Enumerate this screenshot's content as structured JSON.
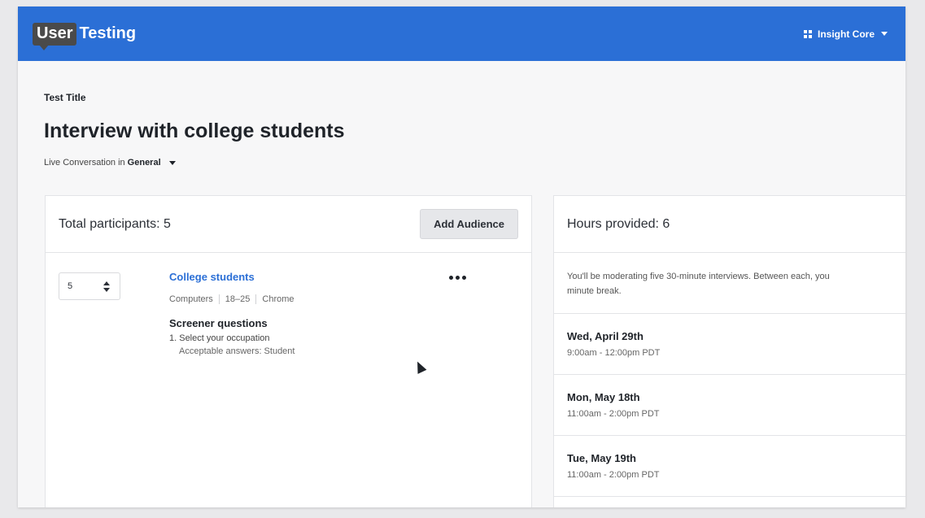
{
  "app": {
    "logo_box": "User",
    "logo_text": "Testing",
    "workspace_label": "Insight Core"
  },
  "test": {
    "label": "Test Title",
    "title": "Interview with college students",
    "type_prefix": "Live Conversation in",
    "category": "General"
  },
  "audience_panel": {
    "title": "Total participants: 5",
    "add_button": "Add Audience",
    "audience": {
      "count": "5",
      "name": "College students",
      "tags": [
        "Computers",
        "18–25",
        "Chrome"
      ],
      "screener_title": "Screener questions",
      "question": "1. Select your occupation",
      "acceptable": "Acceptable answers: Student"
    }
  },
  "hours_panel": {
    "title": "Hours provided: 6",
    "description_line1": "You'll be moderating five 30-minute interviews. Between each, you",
    "description_line2": "minute break.",
    "slots": [
      {
        "day": "Wed, April 29th",
        "time": "9:00am - 12:00pm PDT"
      },
      {
        "day": "Mon, May 18th",
        "time": "11:00am - 2:00pm PDT"
      },
      {
        "day": "Tue, May 19th",
        "time": "11:00am - 2:00pm PDT"
      }
    ]
  },
  "icons": {
    "workspace": "grid-icon",
    "dropdown": "chevron-down-icon",
    "more": "more-horizontal-icon",
    "cursor": "mouse-pointer-icon"
  },
  "colors": {
    "brand_blue": "#2b6fd6",
    "link_blue": "#2b6fd6"
  }
}
